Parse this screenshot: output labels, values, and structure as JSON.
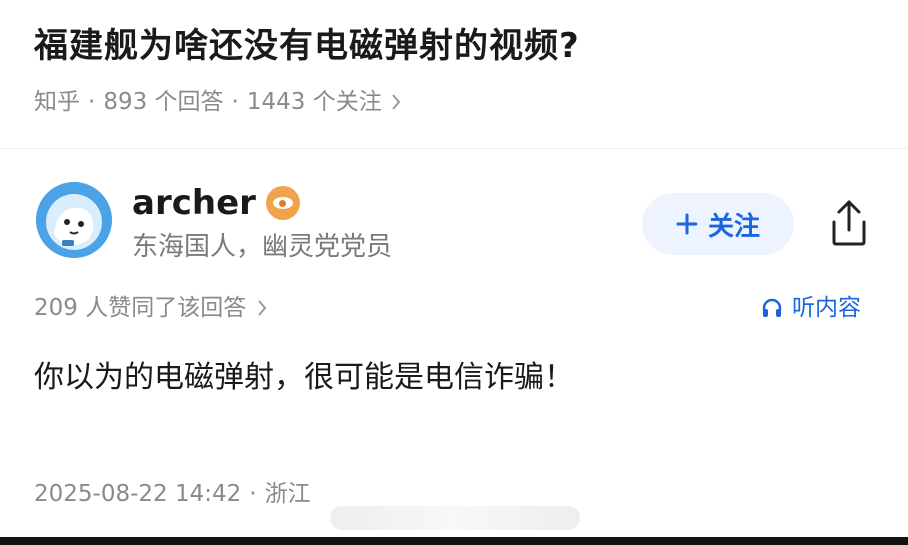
{
  "question": {
    "title": "福建舰为啥还没有电磁弹射的视频?",
    "source": "知乎",
    "answers_count": "893 个回答",
    "followers_count": "1443 个关注"
  },
  "author": {
    "name": "archer",
    "bio": "东海国人，幽灵党党员",
    "follow_label": "关注"
  },
  "answer": {
    "likes_text": "209 人赞同了该回答",
    "listen_label": "听内容",
    "content": "你以为的电磁弹射，很可能是电信诈骗！",
    "date": "2025-08-22 14:42",
    "location": "浙江"
  },
  "icons": {
    "chevron": "chevron-right-icon",
    "plus": "plus-icon",
    "share": "share-icon",
    "headphones": "headphones-icon",
    "badge": "verified-badge-icon"
  },
  "colors": {
    "accent": "#1b66e0",
    "follow_bg": "#eef4ff",
    "meta_text": "#8a8a8a",
    "badge": "#f0a34a"
  }
}
